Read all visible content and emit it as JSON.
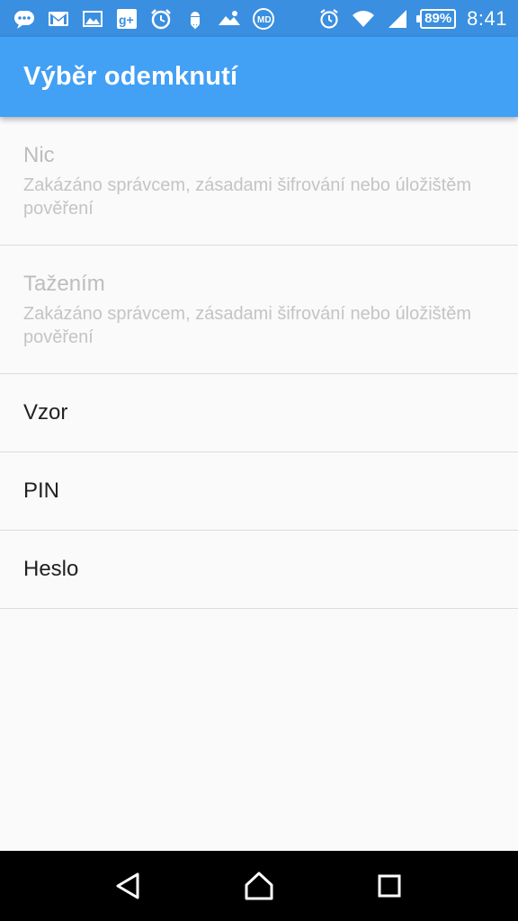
{
  "status_bar": {
    "notification_icons": [
      "chat-icon",
      "gmail-icon",
      "gallery-icon",
      "google-plus-icon",
      "alarm-app-icon",
      "android-download-icon",
      "landscape-icon",
      "md-app-icon"
    ],
    "system_icons": [
      "alarm-clock-icon",
      "wifi-icon",
      "cell-signal-icon"
    ],
    "battery": "89%",
    "time": "8:41"
  },
  "app_bar": {
    "title": "Výběr odemknutí"
  },
  "options": [
    {
      "title": "Nic",
      "subtitle": "Zakázáno správcem, zásadami šifrování nebo úložištěm pověření",
      "enabled": false
    },
    {
      "title": "Tažením",
      "subtitle": "Zakázáno správcem, zásadami šifrování nebo úložištěm pověření",
      "enabled": false
    },
    {
      "title": "Vzor",
      "enabled": true
    },
    {
      "title": "PIN",
      "enabled": true
    },
    {
      "title": "Heslo",
      "enabled": true
    }
  ],
  "nav_bar": {
    "buttons": [
      "back-icon",
      "home-icon",
      "recents-icon"
    ]
  },
  "colors": {
    "status_bar": "#3a8fe0",
    "app_bar": "#42a0f5",
    "background": "#fafafa",
    "disabled_text": "#bdbdbd",
    "enabled_text": "#212121"
  }
}
